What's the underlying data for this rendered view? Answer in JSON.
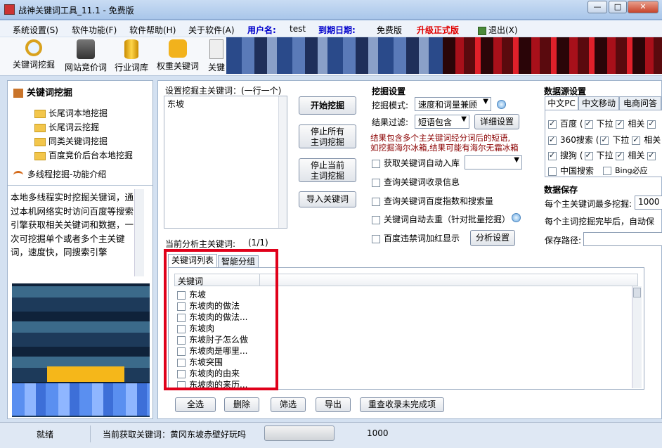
{
  "window": {
    "title": "战神关键词工具_11.1 - 免费版"
  },
  "menu": {
    "system": "系统设置(S)",
    "features": "软件功能(F)",
    "help": "软件帮助(H)",
    "about": "关于软件(A)",
    "user_label": "用户名:",
    "user_value": "test",
    "expire_label": "到期日期:",
    "expire_value": "免费版",
    "upgrade": "升级正式版",
    "exit": "退出(X)"
  },
  "toolbar": {
    "items": [
      "关键词挖掘",
      "网站竞价词",
      "行业词库",
      "权重关键词",
      "关键"
    ]
  },
  "sidebar": {
    "root": "关键词挖掘",
    "children": [
      "长尾词本地挖掘",
      "长尾词云挖掘",
      "同类关键词挖掘",
      "百度竞价后台本地挖掘"
    ],
    "multi": "多线程挖掘-功能介绍",
    "description": "本地多线程实时挖掘关键词，通过本机网络实时访问百度等搜索引擎获取相关关键词和数据，一次可挖掘单个或者多个主关键词，速度快，同搜索引擎"
  },
  "seed": {
    "label": "设置挖掘主关键词：(一行一个)",
    "value": "东坡"
  },
  "buttons": {
    "start": "开始挖掘",
    "stop_all": "停止所有\n主词挖掘",
    "stop_current": "停止当前\n主词挖掘",
    "import": "导入关键词"
  },
  "settings": {
    "title": "挖掘设置",
    "mode_label": "挖掘模式:",
    "mode_value": "速度和词量兼顾",
    "filter_label": "结果过滤:",
    "filter_value": "短语包含",
    "detail_button": "详细设置",
    "hint_line1": "结果包含多个主关键词经分词后的短语,",
    "hint_line2": "如挖掘海尔冰箱,结果可能有海尔无霜冰箱",
    "options": [
      "获取关键词自动入库",
      "查询关键词收录信息",
      "查询关键词百度指数和搜索量",
      "关键词自动去重（针对批量挖掘）",
      "百度违禁词加红显示"
    ],
    "analyze_button": "分析设置"
  },
  "datasource": {
    "title": "数据源设置",
    "tabs": [
      "中文PC",
      "中文移动",
      "电商问答"
    ],
    "rows": [
      {
        "name": "百度",
        "a": "下拉",
        "b": "相关"
      },
      {
        "name": "360搜索",
        "a": "下拉",
        "b": "相关"
      },
      {
        "name": "搜狗",
        "a": "下拉",
        "b": "相关"
      }
    ],
    "row4_a": "中国搜索",
    "row4_b": "Bing必应"
  },
  "save": {
    "title": "数据保存",
    "line1": "每个主关键词最多挖掘:",
    "line1_value": "1000",
    "line2": "每个主词挖掘完毕后，自动保",
    "path_label": "保存路径:"
  },
  "analysis": {
    "label": "当前分析主关键词:",
    "count": "(1/1)",
    "tabs": [
      "关键词列表",
      "智能分组"
    ],
    "column": "关键词",
    "rows": [
      "东坡",
      "东坡肉的做法",
      "东坡肉的做法...",
      "东坡肉",
      "东坡肘子怎么做",
      "东坡肉是哪里...",
      "东坡突围",
      "东坡肉的由来",
      "东坡肉的来历..."
    ]
  },
  "actions": [
    "全选",
    "删除",
    "筛选",
    "导出",
    "重查收录未完成项"
  ],
  "status": {
    "state": "就绪",
    "current": "当前获取关键词：黄冈东坡赤壁好玩吗",
    "progress": 0.0,
    "count": "1000"
  },
  "colors": {
    "accent_blue": "#0000cc",
    "upgrade_red": "#e00000",
    "highlight_box": "#e0001a",
    "hint_red": "#8b0000"
  }
}
